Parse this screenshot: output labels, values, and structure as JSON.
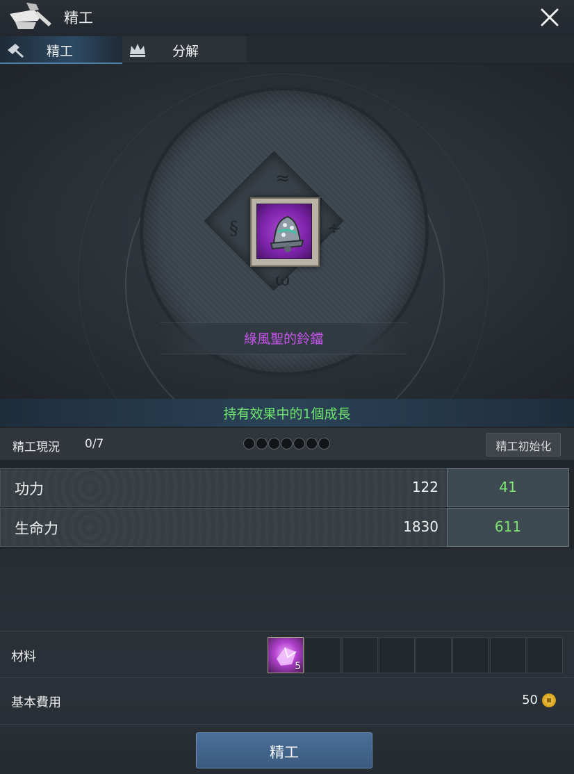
{
  "window": {
    "title": "精工",
    "close_icon": "close-icon",
    "title_icon": "anvil-hammer-icon"
  },
  "tabs": [
    {
      "label": "精工",
      "active": true,
      "icon": "hammer-icon"
    },
    {
      "label": "分解",
      "active": false,
      "icon": "crown-icon"
    }
  ],
  "item": {
    "name": "綠風聖的鈴鐺",
    "name_color": "#c854f0",
    "icon": "bell-icon"
  },
  "growth": {
    "text": "持有效果中的1個成長",
    "color": "#6fe66f"
  },
  "status": {
    "label": "精工現況",
    "value": "0/7",
    "steps_total": 7,
    "steps_filled": 0,
    "reset_label": "精工初始化"
  },
  "stats": [
    {
      "label": "功力",
      "value": "122",
      "bonus": "41"
    },
    {
      "label": "生命力",
      "value": "1830",
      "bonus": "611"
    }
  ],
  "materials": {
    "label": "材料",
    "slots": [
      {
        "icon": "crystal-icon",
        "count": "5"
      },
      {},
      {},
      {},
      {},
      {},
      {},
      {}
    ]
  },
  "cost": {
    "label": "基本費用",
    "value": "50",
    "icon": "coin-icon"
  },
  "action": {
    "label": "精工"
  },
  "colors": {
    "accent": "#4b6f98",
    "bonus": "#7ee36f"
  }
}
